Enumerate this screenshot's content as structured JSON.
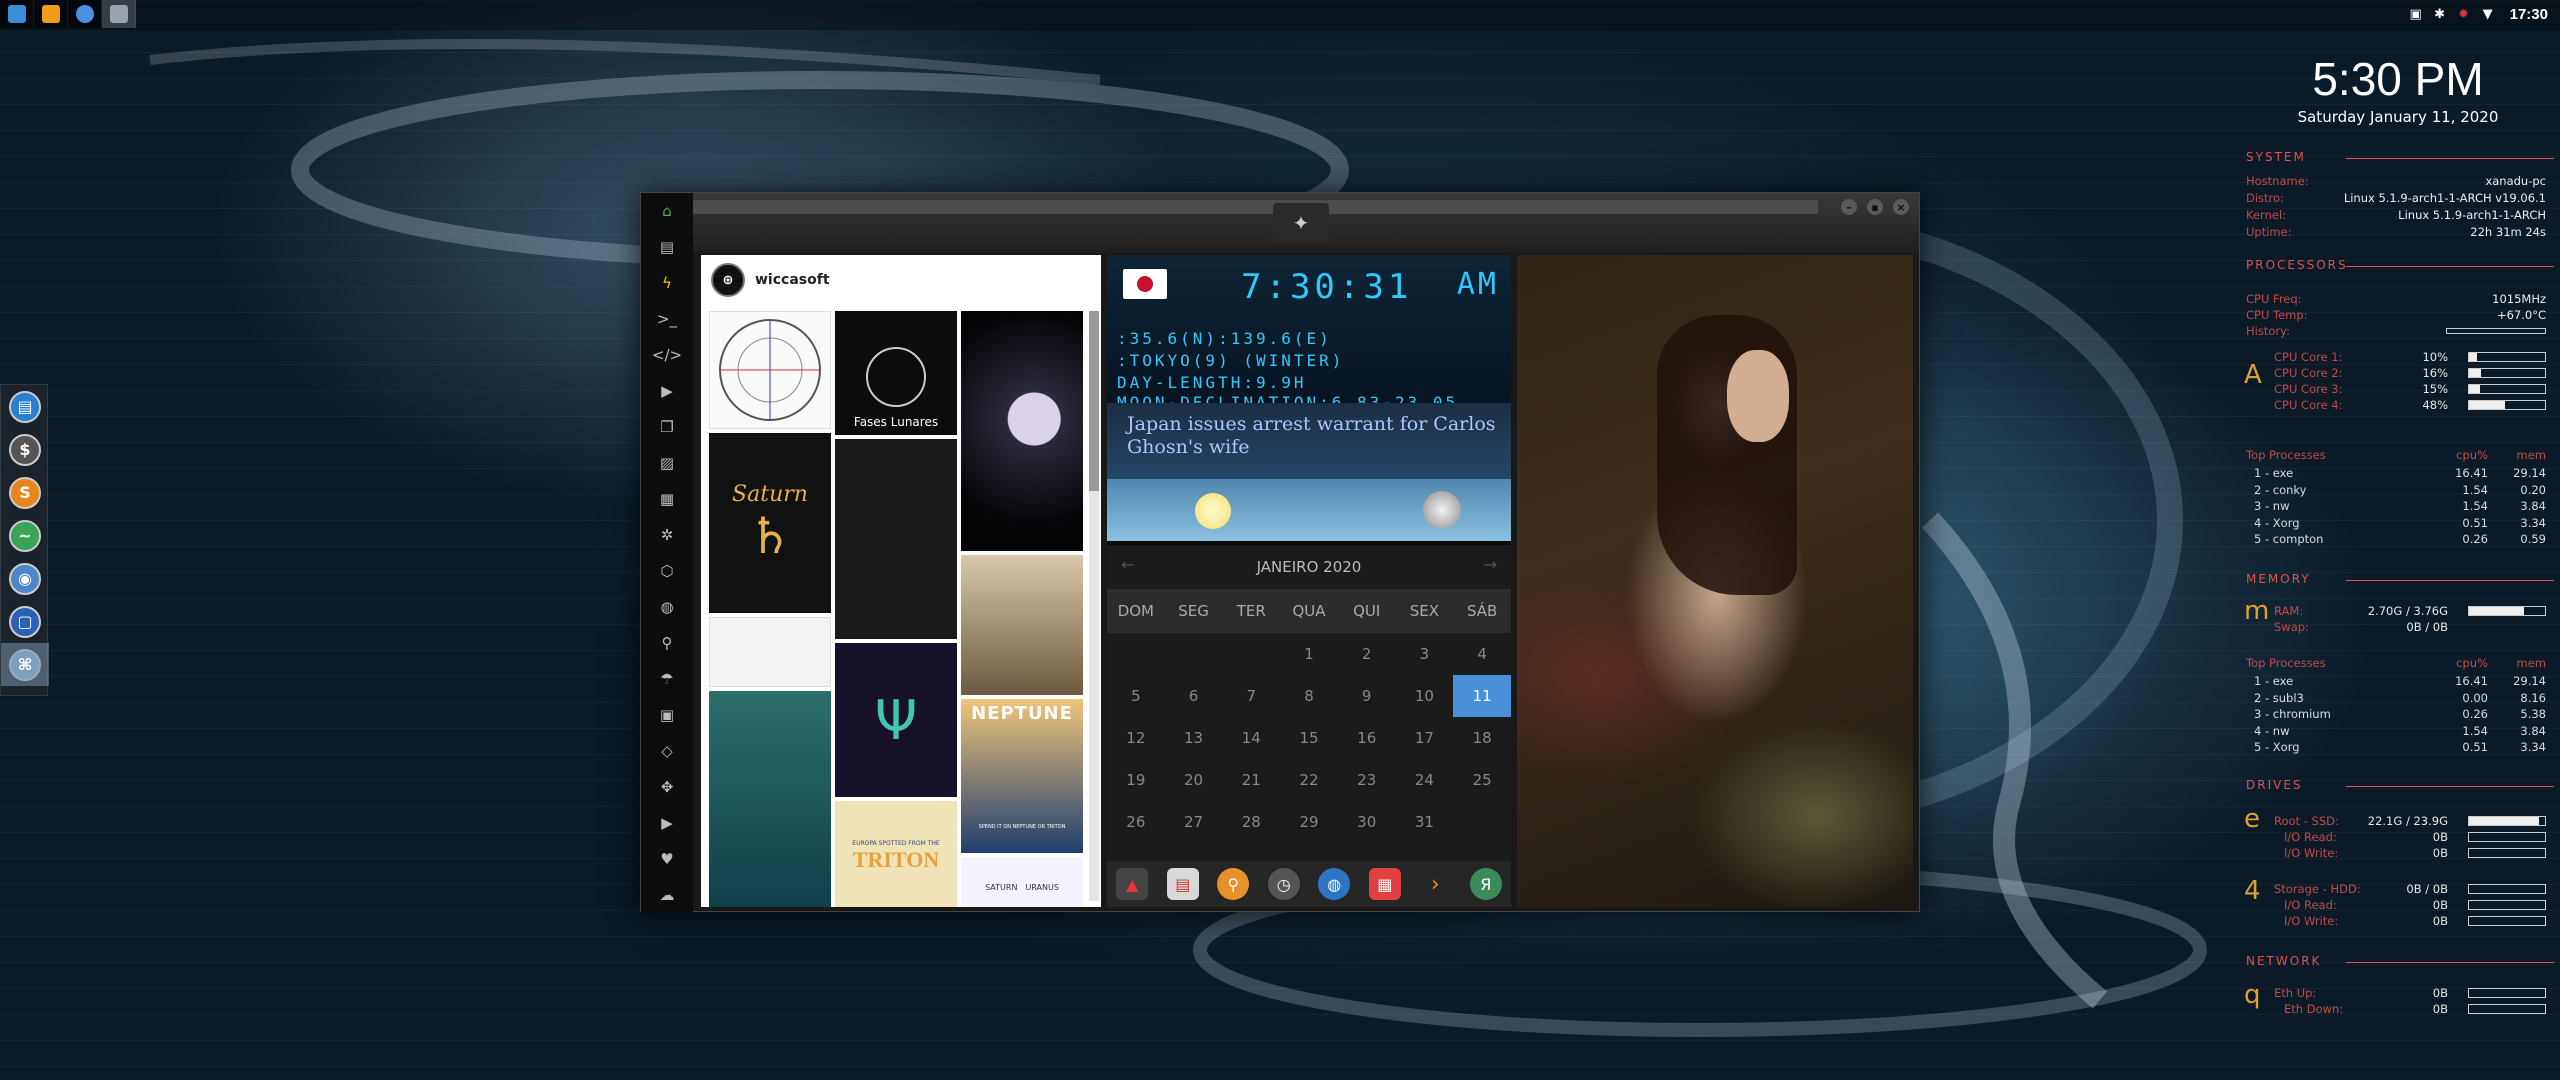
{
  "topbar": {
    "time": "17:30",
    "launchers": [
      "file-manager-icon",
      "sublime-icon",
      "chromium-icon",
      "workspace-icon"
    ]
  },
  "dock": {
    "items": [
      "files-icon",
      "money-icon",
      "s-icon",
      "monitor-icon",
      "chromium-icon",
      "screen-icon",
      "network-icon"
    ]
  },
  "pinterest": {
    "username": "wiccasoft",
    "tiles": {
      "fases": "Fases Lunares",
      "saturn": "Saturn",
      "neptune": "NEPTUNE",
      "neptune_sub": "SPEND IT ON NEPTUNE OR TRITON",
      "triton": "TRITON",
      "triton_head": "EUROPA SPOTTED FROM THE",
      "saturn_bottom": "SATURN",
      "uranus_bottom": "URANUS"
    }
  },
  "clock_widget": {
    "time": "7:30:31",
    "ampm": "AM",
    "coords": ":35.6(N):139.6(E)",
    "city": ":TOKYO(9) (WINTER)",
    "day_length": "DAY-LENGTH:9.9H",
    "moon": "MOON-DECLINATION:6.83-23.05"
  },
  "news": {
    "headline": "Japan issues arrest warrant for Carlos Ghosn's wife"
  },
  "calendar": {
    "month": "JANEIRO 2020",
    "weekdays": [
      "DOM",
      "SEG",
      "TER",
      "QUA",
      "QUI",
      "SEX",
      "SÁB"
    ],
    "days": [
      "",
      "",
      "",
      "1",
      "2",
      "3",
      "4",
      "5",
      "6",
      "7",
      "8",
      "9",
      "10",
      "11",
      "12",
      "13",
      "14",
      "15",
      "16",
      "17",
      "18",
      "19",
      "20",
      "21",
      "22",
      "23",
      "24",
      "25",
      "26",
      "27",
      "28",
      "29",
      "30",
      "31",
      ""
    ],
    "today": "11"
  },
  "conky": {
    "time": "5:30 PM",
    "date": "Saturday January 11, 2020",
    "system_title": "SYSTEM",
    "hostname_k": "Hostname:",
    "hostname_v": "xanadu-pc",
    "distro_k": "Distro:",
    "distro_v": "Linux 5.1.9-arch1-1-ARCH v19.06.1",
    "kernel_k": "Kernel:",
    "kernel_v": "Linux 5.1.9-arch1-1-ARCH",
    "uptime_k": "Uptime:",
    "uptime_v": "22h 31m 24s",
    "proc_title": "PROCESSORS",
    "cpufreq_k": "CPU Freq:",
    "cpufreq_v": "1015MHz",
    "cputemp_k": "CPU Temp:",
    "cputemp_v": "+67.0°C",
    "history_k": "History:",
    "cpu_letter": "A",
    "cores": [
      {
        "label": "CPU Core 1:",
        "value": "10%",
        "fraction": 0.1
      },
      {
        "label": "CPU Core 2:",
        "value": "16%",
        "fraction": 0.16
      },
      {
        "label": "CPU Core 3:",
        "value": "15%",
        "fraction": 0.15
      },
      {
        "label": "CPU Core 4:",
        "value": "48%",
        "fraction": 0.48
      }
    ],
    "top_title": "Top Processes",
    "cpu_h": "cpu%",
    "mem_h": "mem",
    "top_cpu": [
      {
        "n": "1 - exe",
        "c": "16.41",
        "m": "29.14"
      },
      {
        "n": "2 - conky",
        "c": "1.54",
        "m": "0.20"
      },
      {
        "n": "3 - nw",
        "c": "1.54",
        "m": "3.84"
      },
      {
        "n": "4 - Xorg",
        "c": "0.51",
        "m": "3.34"
      },
      {
        "n": "5 - compton",
        "c": "0.26",
        "m": "0.59"
      }
    ],
    "mem_title": "MEMORY",
    "mem_letter": "m",
    "ram_k": "RAM:",
    "ram_v": "2.70G / 3.76G",
    "ram_fraction": 0.72,
    "swap_k": "Swap:",
    "swap_v": "0B / 0B",
    "top_mem": [
      {
        "n": "1 - exe",
        "c": "16.41",
        "m": "29.14"
      },
      {
        "n": "2 - subl3",
        "c": "0.00",
        "m": "8.16"
      },
      {
        "n": "3 - chromium",
        "c": "0.26",
        "m": "5.38"
      },
      {
        "n": "4 - nw",
        "c": "1.54",
        "m": "3.84"
      },
      {
        "n": "5 - Xorg",
        "c": "0.51",
        "m": "3.34"
      }
    ],
    "drives_title": "DRIVES",
    "drive_letter_1": "e",
    "root_k": "Root - SSD:",
    "root_v": "22.1G / 23.9G",
    "root_fraction": 0.92,
    "io_read_k": "I/O Read:",
    "io_read_v": "0B",
    "io_write_k": "I/O Write:",
    "io_write_v": "0B",
    "drive_letter_2": "4",
    "storage_k": "Storage - HDD:",
    "storage_v": "0B / 0B",
    "io_read2_v": "0B",
    "io_write2_v": "0B",
    "net_title": "NETWORK",
    "net_letter": "q",
    "eth_up_k": "Eth Up:",
    "eth_up_v": "0B",
    "eth_down_k": "Eth Down:",
    "eth_down_v": "0B"
  }
}
